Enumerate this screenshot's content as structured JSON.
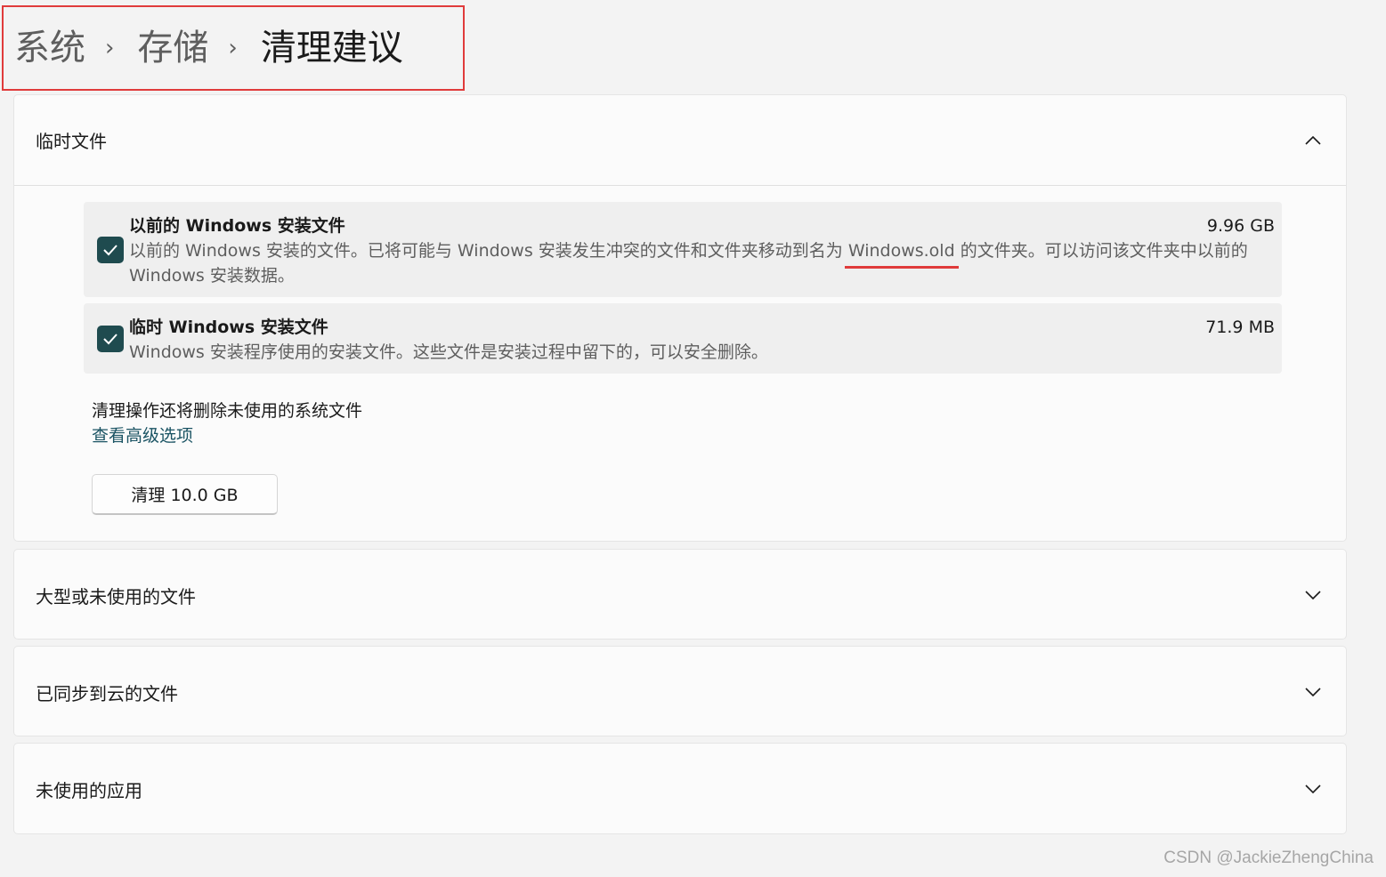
{
  "breadcrumb": {
    "items": [
      "系统",
      "存储",
      "清理建议"
    ],
    "separator": "›"
  },
  "sections": {
    "temp_files": {
      "title": "临时文件",
      "expanded": true,
      "items": [
        {
          "title": "以前的 Windows 安装文件",
          "size": "9.96 GB",
          "checked": true,
          "desc_before": "以前的 Windows 安装的文件。已将可能与 Windows 安装发生冲突的文件和文件夹移动到名为 ",
          "desc_highlight": "Windows.old",
          "desc_after": " 的文件夹。可以访问该文件夹中以前的 Windows 安装数据。"
        },
        {
          "title": "临时 Windows 安装文件",
          "size": "71.9 MB",
          "checked": true,
          "desc": "Windows 安装程序使用的安装文件。这些文件是安装过程中留下的，可以安全删除。"
        }
      ],
      "note": "清理操作还将删除未使用的系统文件",
      "advanced_link": "查看高级选项",
      "clean_button": "清理 10.0 GB"
    },
    "large_files": {
      "title": "大型或未使用的文件"
    },
    "cloud_files": {
      "title": "已同步到云的文件"
    },
    "unused_apps": {
      "title": "未使用的应用"
    }
  },
  "colors": {
    "checkbox": "#1f4b4f",
    "highlight": "#e03b3b",
    "link": "#1a5363"
  },
  "watermark": "CSDN @JackieZhengChina"
}
